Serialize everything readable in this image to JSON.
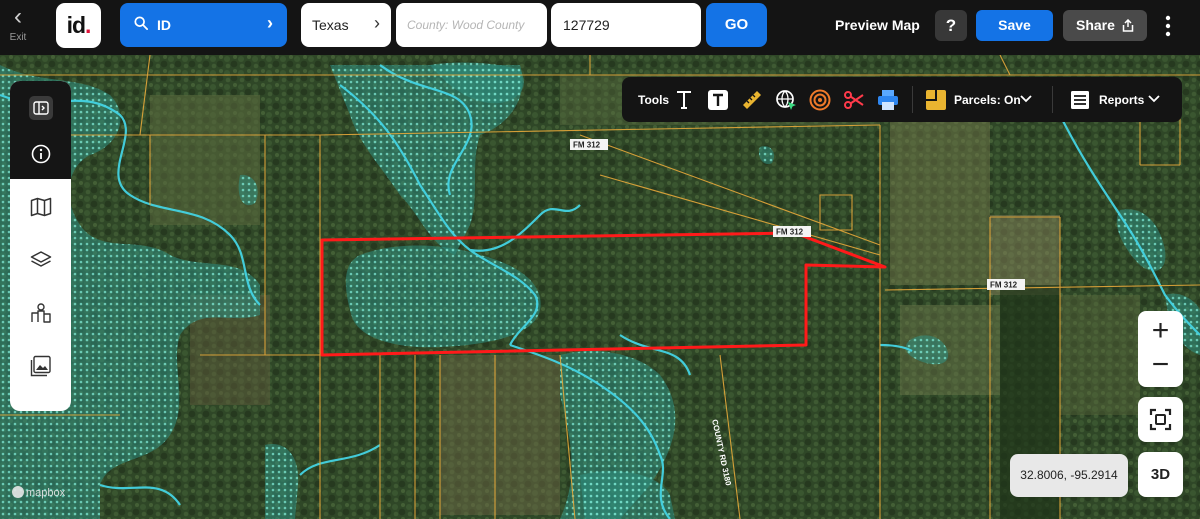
{
  "topbar": {
    "exit_label": "Exit",
    "logo_text": "id",
    "logo_dot": ".",
    "id_search_label": "ID",
    "state_value": "Texas",
    "county_placeholder": "County: Wood County",
    "parcel_value": "127729",
    "go_label": "GO",
    "preview_label": "Preview Map",
    "help_label": "?",
    "save_label": "Save",
    "share_label": "Share"
  },
  "left_panel": {
    "items": [
      {
        "icon": "sidebar-toggle-icon"
      },
      {
        "icon": "info-icon"
      },
      {
        "icon": "map-icon"
      },
      {
        "icon": "layers-icon"
      },
      {
        "icon": "buildings-icon"
      },
      {
        "icon": "image-gallery-icon"
      }
    ]
  },
  "toolsbar": {
    "tools_label": "Tools",
    "tools": [
      "text-outline-icon",
      "text-box-icon",
      "ruler-icon",
      "globe-cursor-icon",
      "buffer-rings-icon",
      "scissors-icon",
      "print-icon"
    ],
    "parcels_label": "Parcels: On",
    "reports_label": "Reports"
  },
  "map": {
    "road_labels": [
      "FM 312",
      "FM 312",
      "FM 312",
      "COUNTY RD 3180"
    ],
    "coordinates": "32.8006, -95.2914",
    "zoom_in": "+",
    "zoom_out": "−",
    "view_3d": "3D",
    "attribution": "mapbox"
  },
  "colors": {
    "accent_blue": "#1473e6",
    "selected_parcel": "#ff1a1a",
    "parcel_lines": "#e6a83a",
    "flood_zone": "#2fb8a8",
    "streams": "#3fd8e8"
  }
}
